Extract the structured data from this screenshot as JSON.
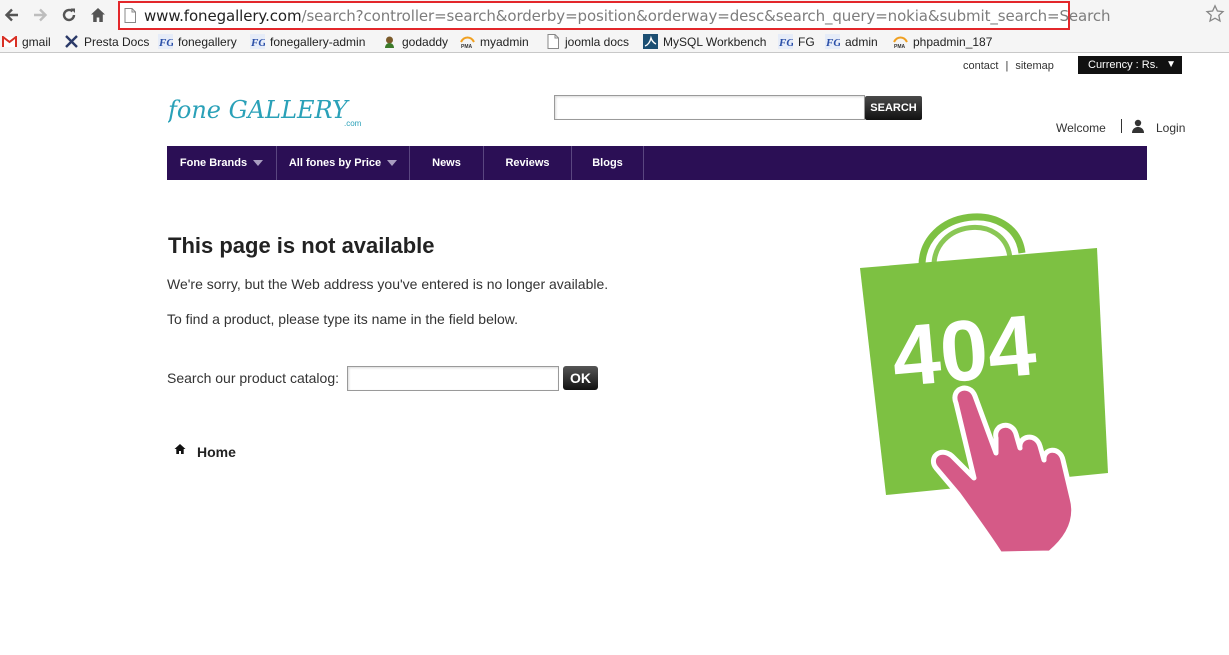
{
  "browser": {
    "url_host": "www.fonegallery.com",
    "url_rest": "/search?controller=search&orderby=position&orderway=desc&search_query=nokia&submit_search=Search",
    "bookmarks": [
      {
        "label": "gmail",
        "icon": "gmail-icon"
      },
      {
        "label": "Presta Docs",
        "icon": "prestashop-icon"
      },
      {
        "label": "fonegallery",
        "icon": "fg-icon"
      },
      {
        "label": "fonegallery-admin",
        "icon": "fg-icon"
      },
      {
        "label": "godaddy",
        "icon": "godaddy-icon"
      },
      {
        "label": "myadmin",
        "icon": "pma-icon"
      },
      {
        "label": "joomla docs",
        "icon": "page-icon"
      },
      {
        "label": "MySQL Workbench",
        "icon": "mysql-icon"
      },
      {
        "label": "FG",
        "icon": "fg-icon"
      },
      {
        "label": "admin",
        "icon": "fg-icon"
      },
      {
        "label": "phpadmin_187",
        "icon": "pma-icon"
      }
    ]
  },
  "header": {
    "contact": "contact",
    "separator": "|",
    "sitemap": "sitemap",
    "currency": "Currency : Rs.",
    "logo_main": "fone GALLERY",
    "logo_sub": ".com",
    "search_value": "",
    "search_button": "SEARCH",
    "welcome": "Welcome",
    "login": "Login"
  },
  "menu": [
    {
      "label": "Fone Brands",
      "dropdown": true
    },
    {
      "label": "All fones by Price",
      "dropdown": true
    },
    {
      "label": "News",
      "dropdown": false
    },
    {
      "label": "Reviews",
      "dropdown": false
    },
    {
      "label": "Blogs",
      "dropdown": false
    }
  ],
  "main": {
    "title": "This page is not available",
    "message": "We're sorry, but the Web address you've entered is no longer available.",
    "instruction": "To find a product, please type its name in the field below.",
    "catalog_label": "Search our product catalog:",
    "catalog_value": "",
    "ok_button": "OK",
    "home_link": "Home"
  },
  "illustration": {
    "text": "404",
    "bag_color": "#7dc142",
    "hand_color": "#d55a87"
  },
  "colors": {
    "menu_bg": "#2b0f55",
    "highlight_border": "#e3272b",
    "logo_color": "#2aa1b8"
  }
}
